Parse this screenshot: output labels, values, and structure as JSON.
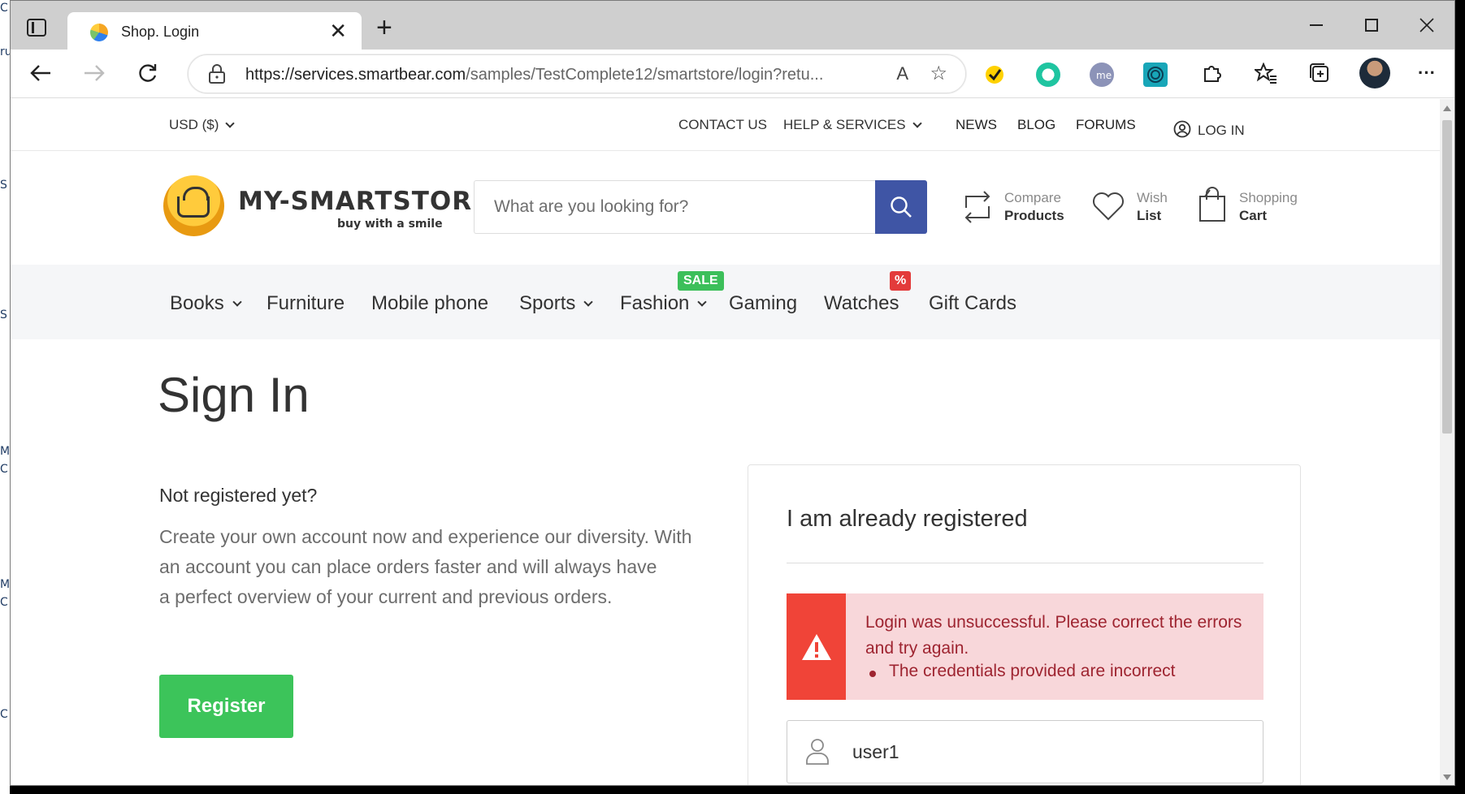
{
  "desktop": {
    "edge_chars": [
      "C",
      "ru",
      "S",
      "S",
      "M",
      "C",
      "M",
      "C",
      "C"
    ]
  },
  "browser": {
    "tab_title": "Shop. Login",
    "tab_close": "✕",
    "new_tab": "+",
    "url_main": "https://services.smartbear.com",
    "url_rest": "/samples/TestComplete12/smartstore/login?retu...",
    "read_aloud": "A",
    "add_favorite": "☆",
    "more": "···"
  },
  "store": {
    "currency": "USD  ($)",
    "top_links": {
      "contact": "CONTACT US",
      "help": "HELP & SERVICES",
      "news": "NEWS",
      "blog": "BLOG",
      "forums": "FORUMS",
      "login": "LOG IN"
    },
    "logo_text": "MY-SMARTSTORE",
    "logo_tagline": "buy with a smile",
    "search_placeholder": "What are you looking for?",
    "tools": {
      "compare_1": "Compare",
      "compare_2": "Products",
      "wish_1": "Wish",
      "wish_2": "List",
      "cart_1": "Shopping",
      "cart_2": "Cart"
    },
    "categories": {
      "books": "Books",
      "furniture": "Furniture",
      "mobile": "Mobile phone",
      "sports": "Sports",
      "fashion": "Fashion",
      "gaming": "Gaming",
      "watches": "Watches",
      "giftcards": "Gift Cards"
    },
    "badges": {
      "sale": "SALE",
      "percent": "%"
    }
  },
  "signin": {
    "title": "Sign In",
    "not_registered": "Not registered yet?",
    "create_line1": "Create your own account now and experience our diversity. With",
    "create_line2": "an account you can place orders faster and will always have",
    "create_line3": "a perfect overview of your current and previous orders.",
    "register_button": "Register",
    "panel_title": "I am already registered",
    "error_message": "Login was unsuccessful. Please correct the errors and try again.",
    "error_item": "The credentials provided are incorrect",
    "username_value": "user1"
  },
  "colors": {
    "search_button": "#3f55a5",
    "register_button": "#3cc45a",
    "sale_badge": "#3cbf5a",
    "percent_badge": "#e33b3b",
    "alert_bg": "#f8d7da",
    "alert_icon_bg": "#f04438",
    "alert_text": "#9e2430"
  },
  "icons": [
    "tabs-icon",
    "favicon",
    "close-icon",
    "plus-icon",
    "minimize-icon",
    "maximize-icon",
    "window-close-icon",
    "back-arrow-icon",
    "forward-arrow-icon",
    "refresh-icon",
    "lock-icon",
    "read-aloud-icon",
    "add-favorite-icon",
    "extension-icons",
    "puzzle-icon",
    "favorites-icon",
    "collections-icon",
    "profile-avatar",
    "more-icon",
    "chevron-down-icon",
    "user-circle-icon",
    "search-icon",
    "compare-icon",
    "heart-icon",
    "shopping-bag-icon",
    "warning-icon",
    "user-icon"
  ]
}
